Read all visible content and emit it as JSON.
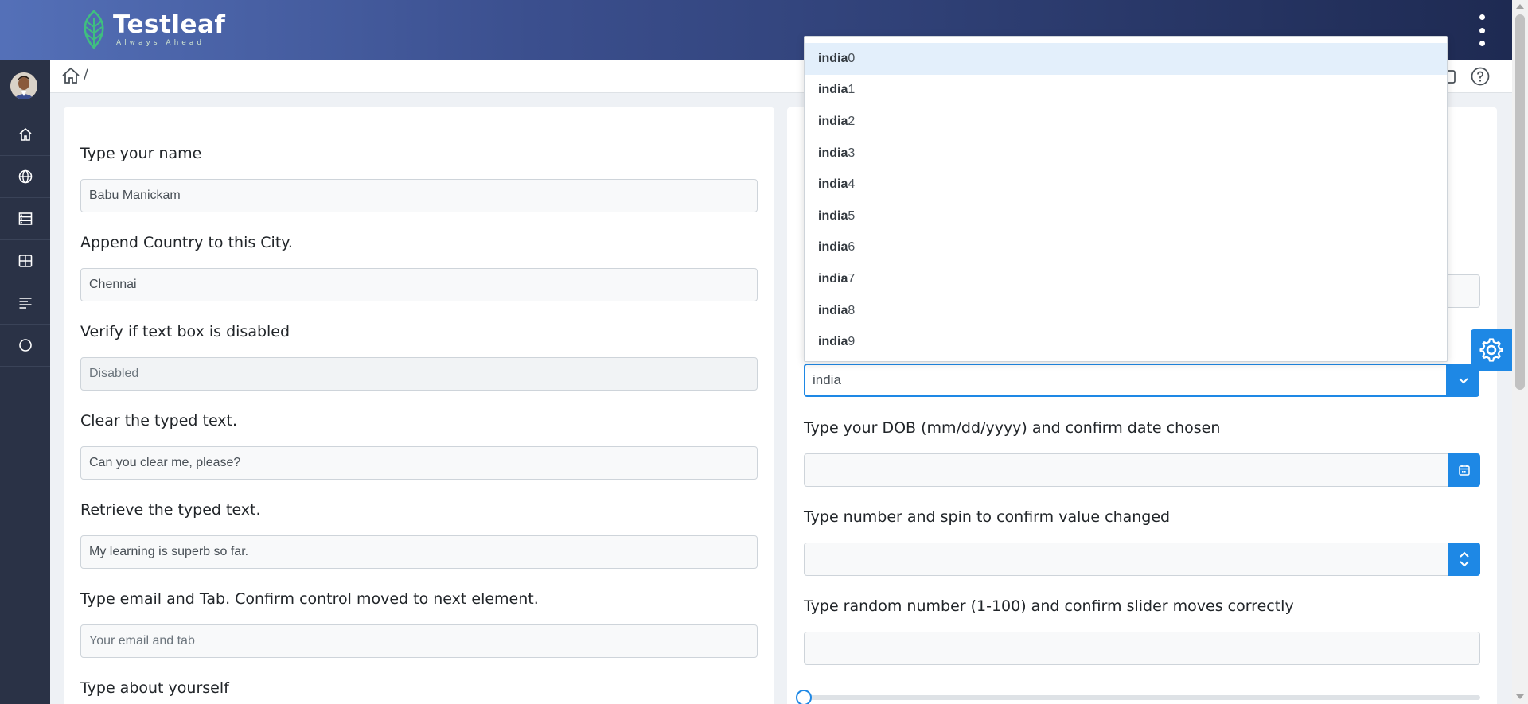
{
  "app": {
    "brand": "Testleaf",
    "tagline": "Always Ahead"
  },
  "breadcrumb": {
    "separator": "/"
  },
  "sidebar": {
    "items": [
      {
        "icon": "home-icon"
      },
      {
        "icon": "globe-icon"
      },
      {
        "icon": "server-icon"
      },
      {
        "icon": "grid-icon"
      },
      {
        "icon": "align-left-icon"
      },
      {
        "icon": "circle-icon"
      }
    ]
  },
  "left_form": {
    "name_label": "Type your name",
    "name_value": "Babu Manickam",
    "append_label": "Append Country to this City.",
    "append_value": "Chennai",
    "disabled_label": "Verify if text box is disabled",
    "disabled_placeholder": "Disabled",
    "clear_label": "Clear the typed text.",
    "clear_value": "Can you clear me, please?",
    "retrieve_label": "Retrieve the typed text.",
    "retrieve_value": "My learning is superb so far.",
    "email_label": "Type email and Tab. Confirm control moved to next element.",
    "email_placeholder": "Your email and tab",
    "about_label": "Type about yourself"
  },
  "right_form": {
    "autocomplete_value": "india",
    "dob_label": "Type your DOB (mm/dd/yyyy) and confirm date chosen",
    "spin_label": "Type number and spin to confirm value changed",
    "slider_label": "Type random number (1-100) and confirm slider moves correctly",
    "slider_value": 0
  },
  "autocomplete": {
    "query": "india",
    "suggestions": [
      {
        "match": "india",
        "rest": "0"
      },
      {
        "match": "india",
        "rest": "1"
      },
      {
        "match": "india",
        "rest": "2"
      },
      {
        "match": "india",
        "rest": "3"
      },
      {
        "match": "india",
        "rest": "4"
      },
      {
        "match": "india",
        "rest": "5"
      },
      {
        "match": "india",
        "rest": "6"
      },
      {
        "match": "india",
        "rest": "7"
      },
      {
        "match": "india",
        "rest": "8"
      },
      {
        "match": "india",
        "rest": "9"
      }
    ],
    "highlighted_index": 0
  },
  "colors": {
    "accent": "#1e88e5",
    "sidebar": "#2a3246",
    "header_start": "#5470b8",
    "header_end": "#1e2a52"
  }
}
